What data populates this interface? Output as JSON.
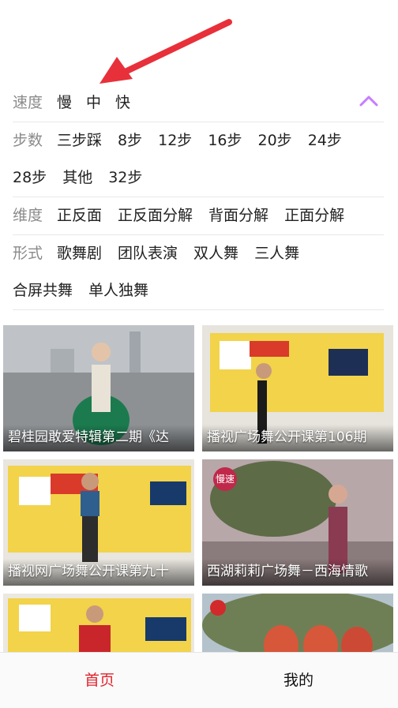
{
  "filters": {
    "speed": {
      "label": "速度",
      "options": [
        "慢",
        "中",
        "快"
      ]
    },
    "steps": {
      "label": "步数",
      "options": [
        "三步踩",
        "8步",
        "12步",
        "16步",
        "20步",
        "24步",
        "28步",
        "其他",
        "32步"
      ]
    },
    "dimension": {
      "label": "维度",
      "options": [
        "正反面",
        "正反面分解",
        "背面分解",
        "正面分解"
      ]
    },
    "form": {
      "label": "形式",
      "options": [
        "歌舞剧",
        "团队表演",
        "双人舞",
        "三人舞",
        "合屏共舞",
        "单人独舞"
      ]
    },
    "collapse_icon": "chevron-up-icon",
    "accent_color": "#c77dff"
  },
  "annotation": {
    "arrow_color": "#e8303a",
    "icon": "arrow-icon"
  },
  "videos": [
    {
      "title": "碧桂园敢爱特辑第二期《达"
    },
    {
      "title": "播视广场舞公开课第106期"
    },
    {
      "title": "播视网广场舞公开课第九十"
    },
    {
      "title": "西湖莉莉广场舞－西海情歌",
      "badge": "慢速"
    },
    {
      "title": ""
    },
    {
      "title": ""
    }
  ],
  "tabs": {
    "home": "首页",
    "mine": "我的",
    "active_color": "#e0242d"
  }
}
